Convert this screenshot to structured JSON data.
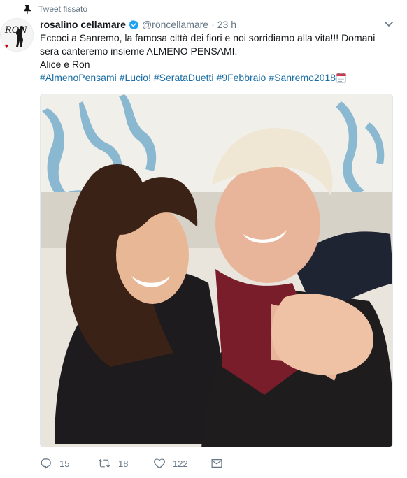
{
  "pinned_label": "Tweet fissato",
  "author": {
    "name": "rosalino cellamare",
    "handle": "@roncellamare",
    "time": "23 h",
    "separator": "·",
    "avatar_text": "RON"
  },
  "tweet": {
    "line1": "Eccoci a Sanremo, la famosa città dei fiori e noi sorridiamo alla vita!!! Domani sera canteremo insieme ALMENO PENSAMI.",
    "line2": "Alice e Ron",
    "hashtags": [
      "#AlmenoPensami",
      "#Lucio!",
      "#SerataDuetti",
      "#9Febbraio",
      "#Sanremo2018"
    ]
  },
  "actions": {
    "replies": "15",
    "retweets": "18",
    "likes": "122"
  },
  "colors": {
    "link": "#1b6ea6",
    "muted": "#657786",
    "verified": "#1da1f2"
  },
  "icons": [
    "pin-icon",
    "verified-icon",
    "chevron-down-icon",
    "calendar-emoji-icon",
    "reply-icon",
    "retweet-icon",
    "heart-icon",
    "envelope-icon"
  ]
}
